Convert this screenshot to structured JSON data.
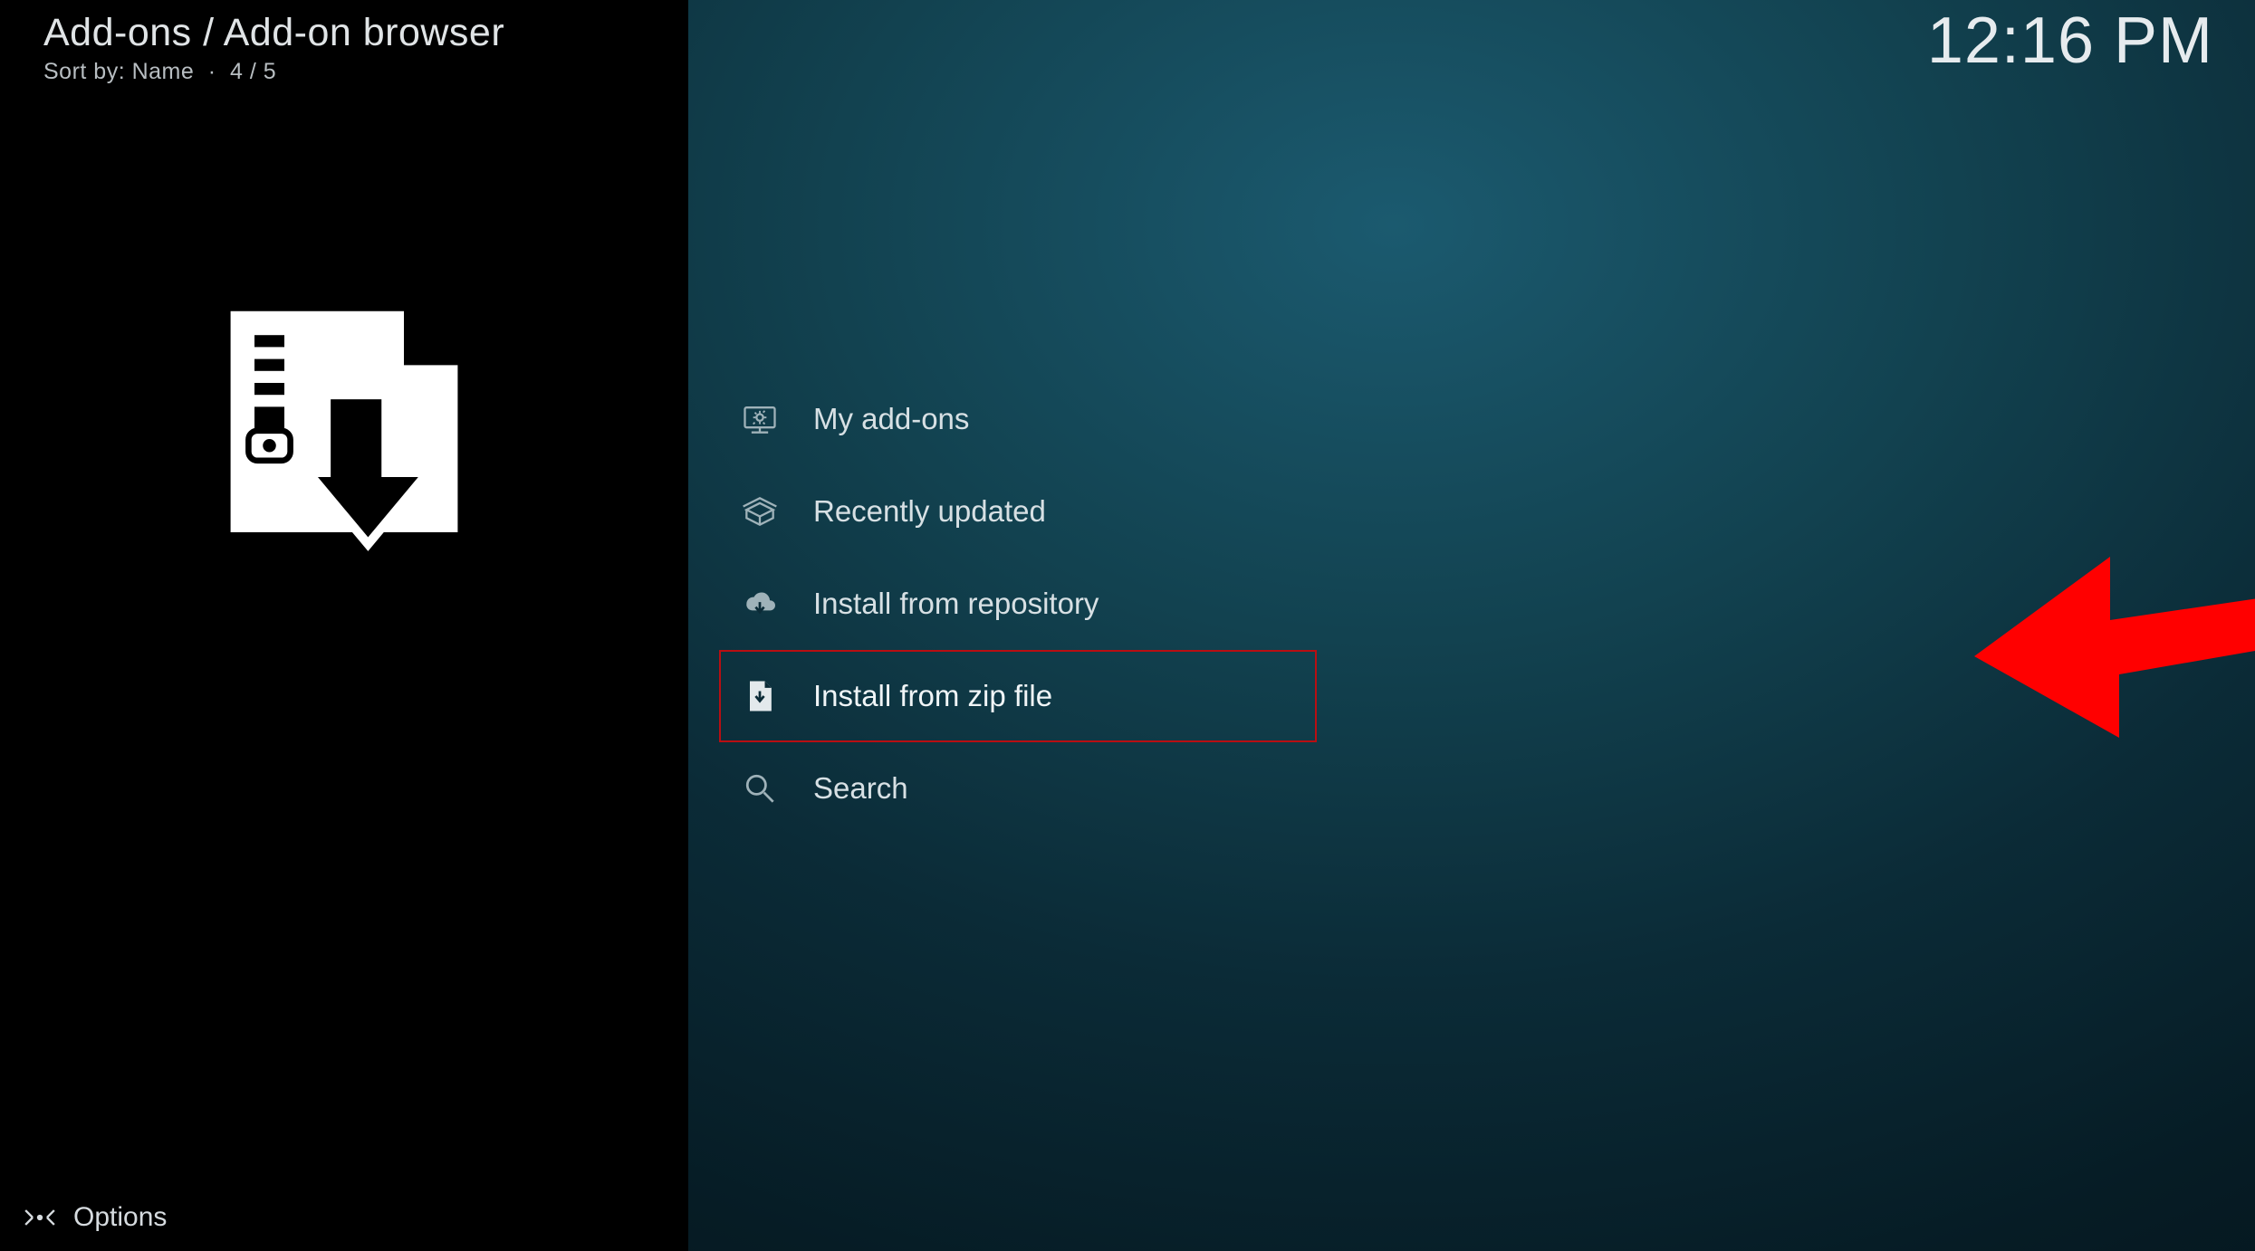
{
  "header": {
    "title": "Add-ons / Add-on browser",
    "sort_label": "Sort by: Name",
    "position": "4 / 5"
  },
  "clock": "12:16 PM",
  "menu": {
    "items": [
      {
        "label": "My add-ons",
        "icon": "monitor-addon",
        "selected": false
      },
      {
        "label": "Recently updated",
        "icon": "open-box",
        "selected": false
      },
      {
        "label": "Install from repository",
        "icon": "cloud-download",
        "selected": false
      },
      {
        "label": "Install from zip file",
        "icon": "zip-file",
        "selected": true
      },
      {
        "label": "Search",
        "icon": "magnifier",
        "selected": false
      }
    ]
  },
  "footer": {
    "options_label": "Options"
  },
  "annotation": {
    "arrow_target": "Install from zip file",
    "color": "#ff0000"
  }
}
